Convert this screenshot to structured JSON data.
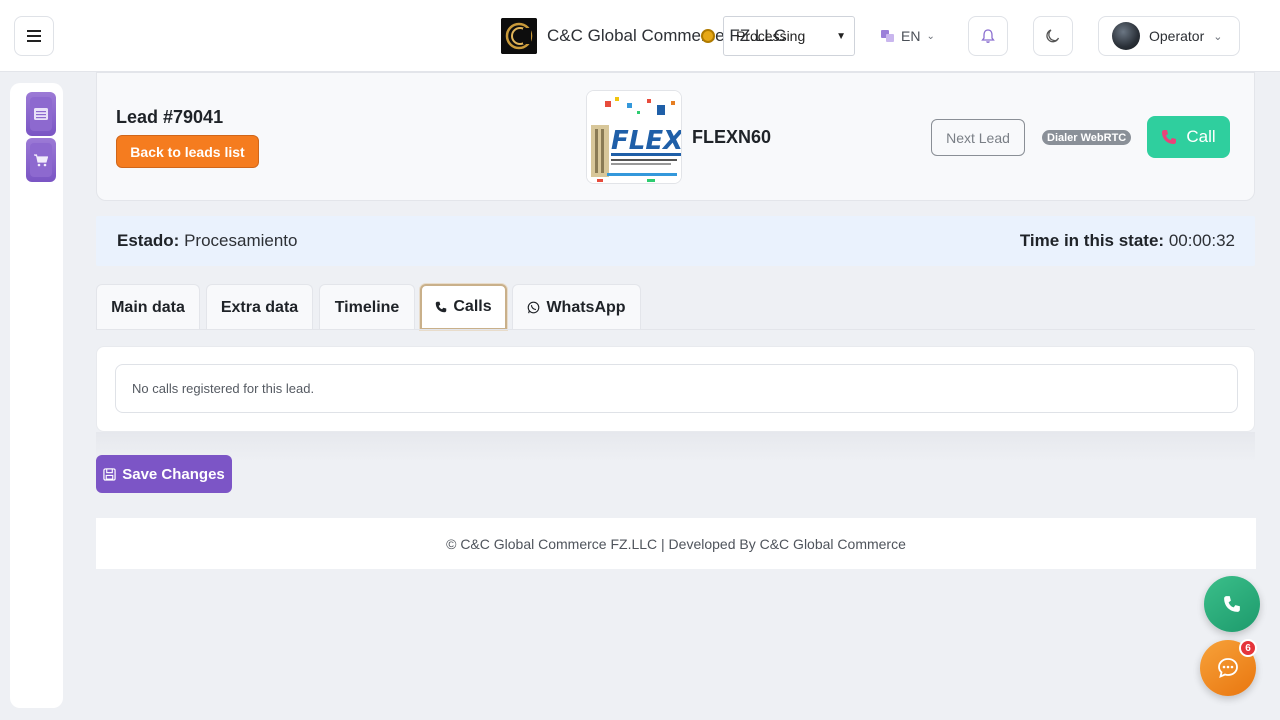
{
  "header": {
    "company_name": "C&C Global Commerce FZ.LLC",
    "status_select_value": "Processing",
    "language": "EN",
    "user_name": "Operator"
  },
  "lead": {
    "title": "Lead #79041",
    "back_label": "Back to leads list",
    "product_name": "FLEXN60",
    "next_label": "Next Lead",
    "dialer_badge": "Dialer WebRTC",
    "call_label": "Call"
  },
  "status": {
    "state_label": "Estado:",
    "state_value": "Procesamiento",
    "time_label": "Time in this state:",
    "time_value": "00:00:32"
  },
  "tabs": [
    {
      "label": "Main data"
    },
    {
      "label": "Extra data"
    },
    {
      "label": "Timeline"
    },
    {
      "label": "Calls",
      "active": true
    },
    {
      "label": "WhatsApp"
    }
  ],
  "calls": {
    "empty_message": "No calls registered for this lead."
  },
  "actions": {
    "save_label": "Save Changes"
  },
  "footer": {
    "text": "© C&C Global Commerce FZ.LLC | Developed By C&C Global Commerce"
  },
  "chat": {
    "badge_count": "6"
  },
  "colors": {
    "accent_orange": "#f57c1f",
    "accent_purple": "#7c55c6",
    "accent_green": "#2fcf9e",
    "status_bg": "#eaf2fd"
  }
}
